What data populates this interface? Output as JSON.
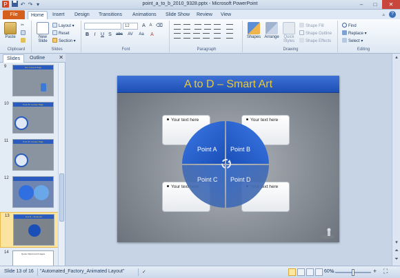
{
  "window": {
    "title": "point_a_to_b_2010_9328.pptx - Microsoft PowerPoint",
    "controls": [
      "–",
      "□",
      "✕"
    ]
  },
  "ribbon_tabs": [
    "File",
    "Home",
    "Insert",
    "Design",
    "Transitions",
    "Animations",
    "Slide Show",
    "Review",
    "View"
  ],
  "ribbon": {
    "clipboard": {
      "paste": "Paste",
      "label": "Clipboard"
    },
    "slides": {
      "new_slide": "New Slide",
      "layout": "Layout",
      "reset": "Reset",
      "section": "Section",
      "label": "Slides"
    },
    "font": {
      "font_size": "12",
      "label": "Font",
      "bold": "B",
      "italic": "I",
      "underline": "U",
      "strike": "S",
      "abc": "abc",
      "spacing": "AV",
      "case": "Aa",
      "grow": "A",
      "shrink": "A"
    },
    "paragraph": {
      "label": "Paragraph"
    },
    "drawing": {
      "shapes": "Shapes",
      "arrange": "Arrange",
      "quick_styles": "Quick Styles",
      "shape_fill": "Shape Fill",
      "shape_outline": "Shape Outline",
      "shape_effects": "Shape Effects",
      "label": "Drawing"
    },
    "editing": {
      "find": "Find",
      "replace": "Replace",
      "select": "Select",
      "label": "Editing"
    }
  },
  "pane": {
    "tabs": [
      "Slides",
      "Outline"
    ],
    "thumbnails": [
      {
        "number": "9",
        "title": "Our Content Page"
      },
      {
        "number": "10",
        "title": "Point B: Content Page"
      },
      {
        "number": "11",
        "title": "Point B: Content Page"
      },
      {
        "number": "12",
        "title": ""
      },
      {
        "number": "13",
        "title": "A to D – Smart Art"
      },
      {
        "number": "14",
        "title": "Quote Clipart and Images"
      }
    ]
  },
  "slide": {
    "title": "A to D – Smart Art",
    "textboxes": [
      "Your text here",
      "Your text here",
      "Your text here",
      "Your text here"
    ],
    "quadrants": [
      "Point A",
      "Point B",
      "Point C",
      "Point D"
    ]
  },
  "status": {
    "slide_info": "Slide 13 of 16",
    "theme": "\"Automated_Factory_Animated Layout\"",
    "zoom": "60%",
    "zoom_fraction": 0.5
  },
  "colors": {
    "title_bar": "#2a5cbf",
    "title_text": "#e8ca3c",
    "file_tab": "#d45f1c",
    "quad_dark": "#1b4fb8",
    "quad_light": "#2f6fe0"
  }
}
